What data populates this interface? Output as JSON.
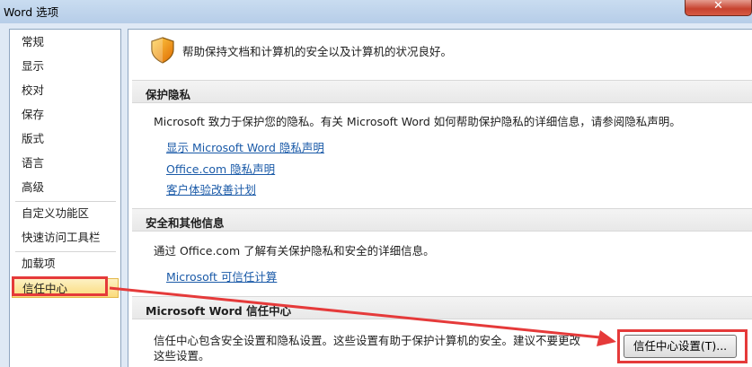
{
  "window": {
    "title": "Word 选项",
    "close_glyph": "✕"
  },
  "sidebar": {
    "items": [
      {
        "label": "常规"
      },
      {
        "label": "显示"
      },
      {
        "label": "校对"
      },
      {
        "label": "保存"
      },
      {
        "label": "版式"
      },
      {
        "label": "语言"
      },
      {
        "label": "高级"
      },
      {
        "label": "自定义功能区"
      },
      {
        "label": "快速访问工具栏"
      },
      {
        "label": "加载项"
      },
      {
        "label": "信任中心",
        "selected": true
      }
    ]
  },
  "main": {
    "intro": "帮助保持文档和计算机的安全以及计算机的状况良好。",
    "intro_icon": "shield-icon",
    "privacy": {
      "header": "保护隐私",
      "text": "Microsoft 致力于保护您的隐私。有关 Microsoft Word 如何帮助保护隐私的详细信息，请参阅隐私声明。",
      "links": [
        "显示 Microsoft Word 隐私声明",
        "Office.com 隐私声明",
        "客户体验改善计划"
      ]
    },
    "security": {
      "header": "安全和其他信息",
      "text": "通过 Office.com 了解有关保护隐私和安全的详细信息。",
      "link": "Microsoft 可信任计算"
    },
    "trust_center": {
      "header": "Microsoft Word 信任中心",
      "text_line1": "信任中心包含安全设置和隐私设置。这些设置有助于保护计算机的安全。建议不要更改",
      "text_line2": "这些设置。",
      "button_label": "信任中心设置(T)..."
    }
  },
  "colors": {
    "annotation_red": "#e53a3a",
    "link_blue": "#1a5aa8",
    "selected_bg": "#fbdb7a"
  }
}
